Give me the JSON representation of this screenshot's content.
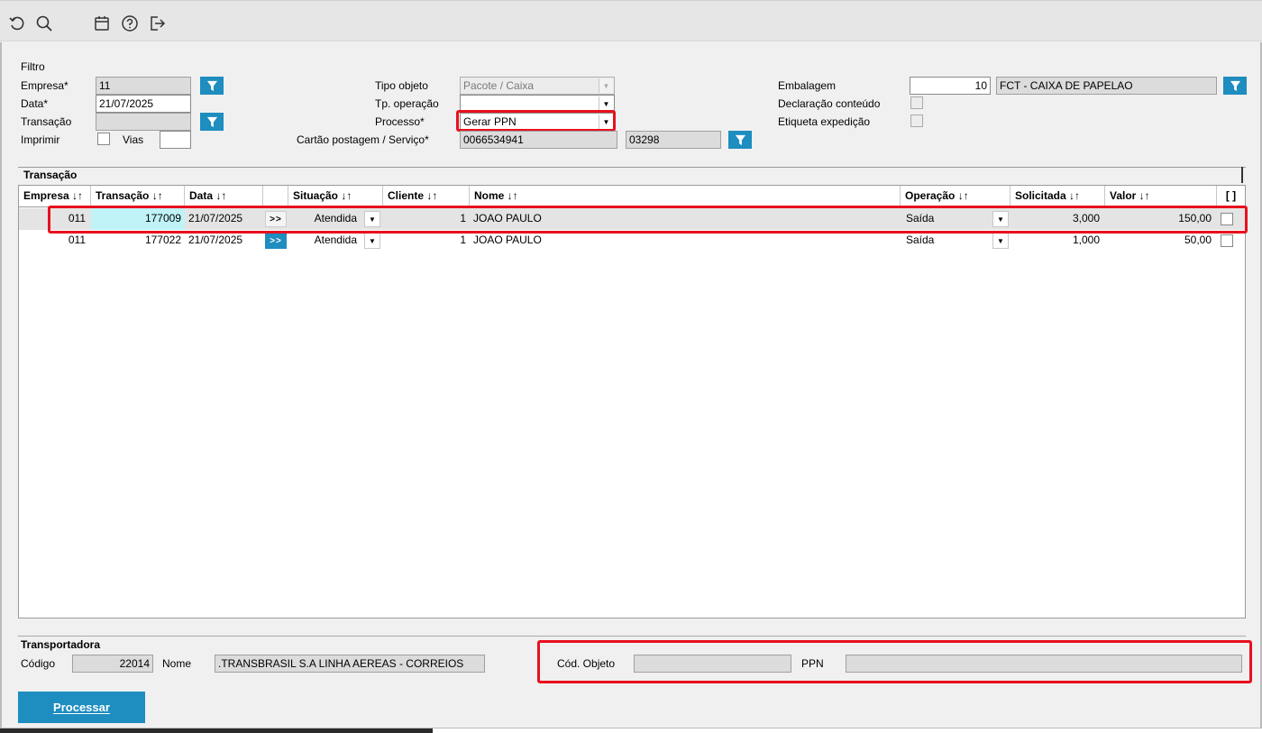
{
  "toolbar": {
    "icons": [
      "undo-icon",
      "search-icon",
      "calendar-icon",
      "help-icon",
      "exit-icon"
    ]
  },
  "filter": {
    "title": "Filtro",
    "empresa_label": "Empresa*",
    "empresa_value": "11",
    "data_label": "Data*",
    "data_value": "21/07/2025",
    "transacao_label": "Transação",
    "transacao_value": "",
    "imprimir_label": "Imprimir",
    "vias_label": "Vias",
    "vias_value": "",
    "tipo_objeto_label": "Tipo objeto",
    "tipo_objeto_value": "Pacote / Caixa",
    "tp_operacao_label": "Tp. operação",
    "tp_operacao_value": "",
    "processo_label": "Processo*",
    "processo_value": "Gerar PPN",
    "cartao_label": "Cartão postagem / Serviço*",
    "cartao_value": "0066534941",
    "servico_value": "03298",
    "embalagem_label": "Embalagem",
    "embalagem_code": "10",
    "embalagem_desc": "FCT - CAIXA DE PAPELAO",
    "declaracao_label": "Declaração conteúdo",
    "etiqueta_label": "Etiqueta expedição"
  },
  "grid": {
    "title": "Transação",
    "columns": [
      "Empresa ↓↑",
      "Transação ↓↑",
      "Data ↓↑",
      "",
      "Situação ↓↑",
      "Cliente ↓↑",
      "Nome ↓↑",
      "Operação ↓↑",
      "Solicitada ↓↑",
      "Valor ↓↑",
      "[ ]"
    ],
    "goto_label": ">>",
    "rows": [
      {
        "empresa": "011",
        "transacao": "177009",
        "data": "21/07/2025",
        "situacao": "Atendida",
        "cliente": "1",
        "nome": "JOAO PAULO",
        "operacao": "Saída",
        "solicitada": "3,000",
        "valor": "150,00"
      },
      {
        "empresa": "011",
        "transacao": "177022",
        "data": "21/07/2025",
        "situacao": "Atendida",
        "cliente": "1",
        "nome": "JOAO PAULO",
        "operacao": "Saída",
        "solicitada": "1,000",
        "valor": "50,00"
      }
    ]
  },
  "transportadora": {
    "title": "Transportadora",
    "codigo_label": "Código",
    "codigo_value": "22014",
    "nome_label": "Nome",
    "nome_value": ".TRANSBRASIL S.A LINHA AEREAS - CORREIOS",
    "cod_objeto_label": "Cód. Objeto",
    "cod_objeto_value": "",
    "ppn_label": "PPN",
    "ppn_value": ""
  },
  "actions": {
    "processar_label": "Processar"
  },
  "colors": {
    "accent": "#1e8dbf",
    "highlight_red": "#e8101e",
    "selected_cell": "#bff3f8"
  }
}
